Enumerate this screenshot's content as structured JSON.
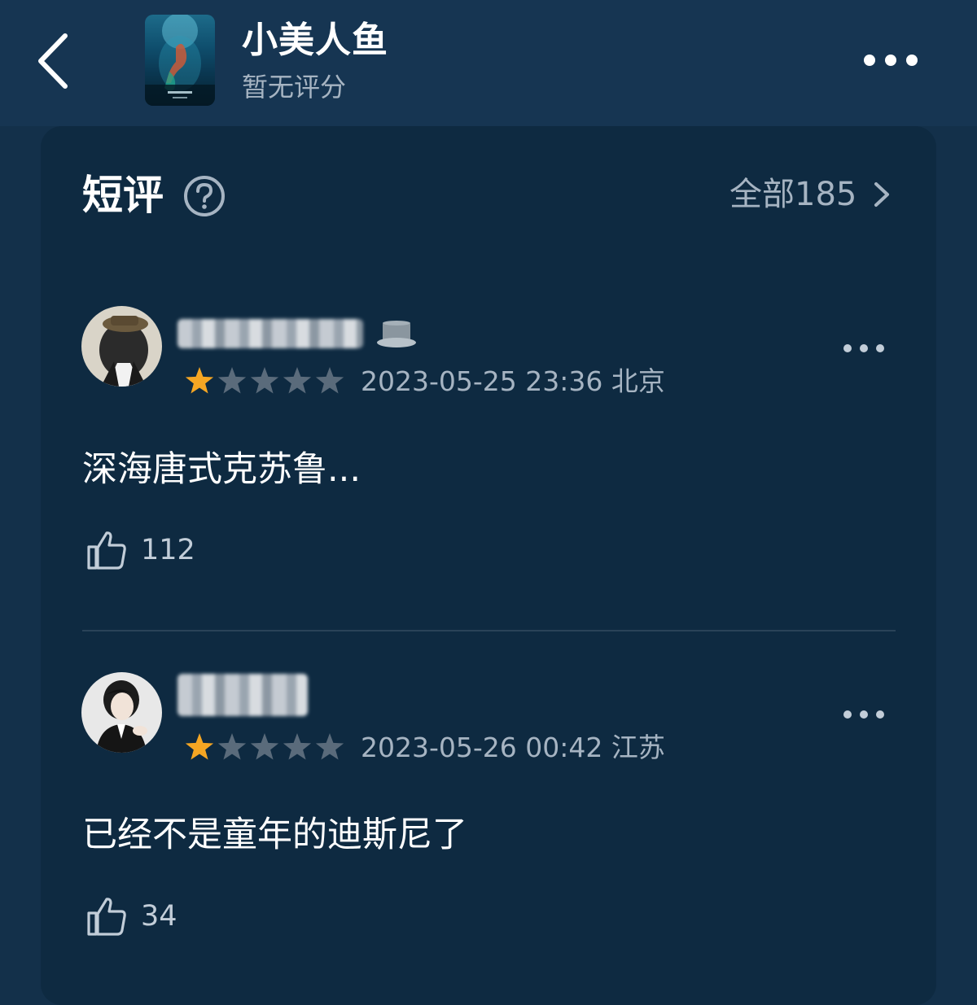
{
  "header": {
    "title": "小美人鱼",
    "rating_text": "暂无评分"
  },
  "section": {
    "title": "短评",
    "all_label": "全部185"
  },
  "reviews": [
    {
      "rating": 1,
      "max_rating": 5,
      "datetime": "2023-05-25 23:36",
      "location": "北京",
      "text": "深海唐式克苏鲁...",
      "likes": "112"
    },
    {
      "rating": 1,
      "max_rating": 5,
      "datetime": "2023-05-26 00:42",
      "location": "江苏",
      "text": "已经不是童年的迪斯尼了",
      "likes": "34"
    }
  ],
  "icons": {
    "back": "chevron-left-icon",
    "more": "more-horizontal-icon",
    "help": "question-circle-icon",
    "like": "thumbs-up-icon",
    "star": "star-icon"
  },
  "colors": {
    "background": "#13304a",
    "header": "#163552",
    "card": "#0e2a41",
    "star_active": "#f5a623",
    "star_inactive": "#5a6b7b",
    "secondary_text": "#a6b4c2"
  }
}
